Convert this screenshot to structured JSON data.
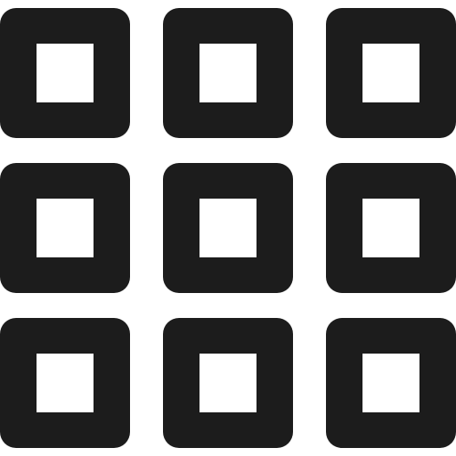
{
  "icon": {
    "semantic": "grid-view-icon",
    "color": "#1c1c1c",
    "background": "#ffffff",
    "rows": 3,
    "columns": 3
  }
}
